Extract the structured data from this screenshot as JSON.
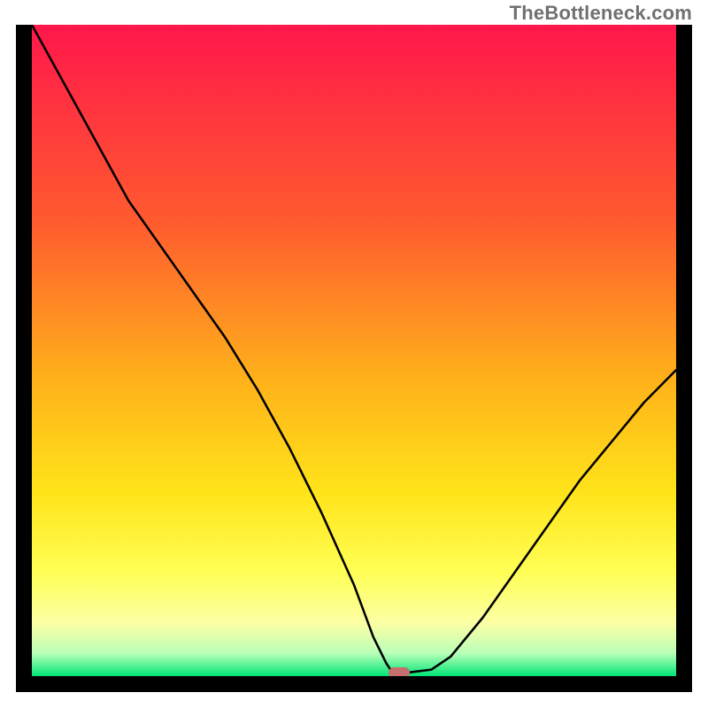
{
  "watermark": "TheBottleneck.com",
  "chart_data": {
    "type": "line",
    "title": "",
    "xlabel": "",
    "ylabel": "",
    "x": [
      0,
      5,
      10,
      15,
      20,
      25,
      30,
      35,
      40,
      45,
      50,
      53,
      55,
      56,
      58,
      62,
      65,
      70,
      75,
      80,
      85,
      90,
      95,
      100
    ],
    "values": [
      100,
      91,
      82,
      73,
      66,
      59,
      52,
      44,
      35,
      25,
      14,
      6,
      2,
      0.5,
      0.5,
      1,
      3,
      9,
      16,
      23,
      30,
      36,
      42,
      47
    ],
    "xlim": [
      0,
      100
    ],
    "ylim": [
      0,
      100
    ],
    "grid": false,
    "marker": {
      "x": 57,
      "y": 0.5,
      "color": "#c76e6e"
    },
    "background_gradient": {
      "stops": [
        {
          "offset": 0.0,
          "color": "#ff174b"
        },
        {
          "offset": 0.3,
          "color": "#ff5a2f"
        },
        {
          "offset": 0.55,
          "color": "#ffb31a"
        },
        {
          "offset": 0.72,
          "color": "#ffe41a"
        },
        {
          "offset": 0.84,
          "color": "#ffff55"
        },
        {
          "offset": 0.92,
          "color": "#fbffa5"
        },
        {
          "offset": 0.965,
          "color": "#b8ffb8"
        },
        {
          "offset": 1.0,
          "color": "#00e676"
        }
      ]
    }
  }
}
